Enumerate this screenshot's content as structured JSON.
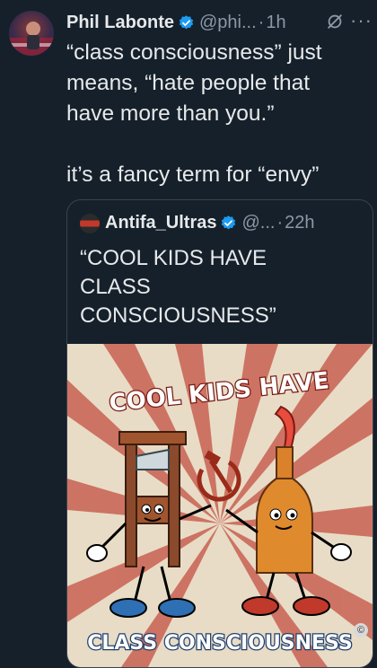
{
  "tweet": {
    "display_name": "Phil Labonte",
    "handle": "@phi...",
    "separator": "·",
    "time": "1h",
    "text": "“class consciousness” just\nmeans, “hate people that\nhave more than you.”\n\nit’s a fancy term for “envy”"
  },
  "quote": {
    "display_name": "Antifa_Ultras",
    "handle": "@...",
    "separator": "·",
    "time": "22h",
    "text": "“COOL KIDS HAVE\nCLASS\nCONSCIOUSNESS”",
    "image": {
      "top_caption": "COOL KIDS HAVE",
      "bottom_caption": "CLASS CONSCIOUSNESS"
    }
  },
  "icons": {
    "verified": "verified-badge-icon",
    "mute": "mute-icon",
    "more": "more-options-icon"
  },
  "colors": {
    "background": "#15202b",
    "text": "#e7e9ea",
    "secondary_text": "#8b98a5",
    "verified": "#1d9bf0",
    "border": "#38444d"
  }
}
